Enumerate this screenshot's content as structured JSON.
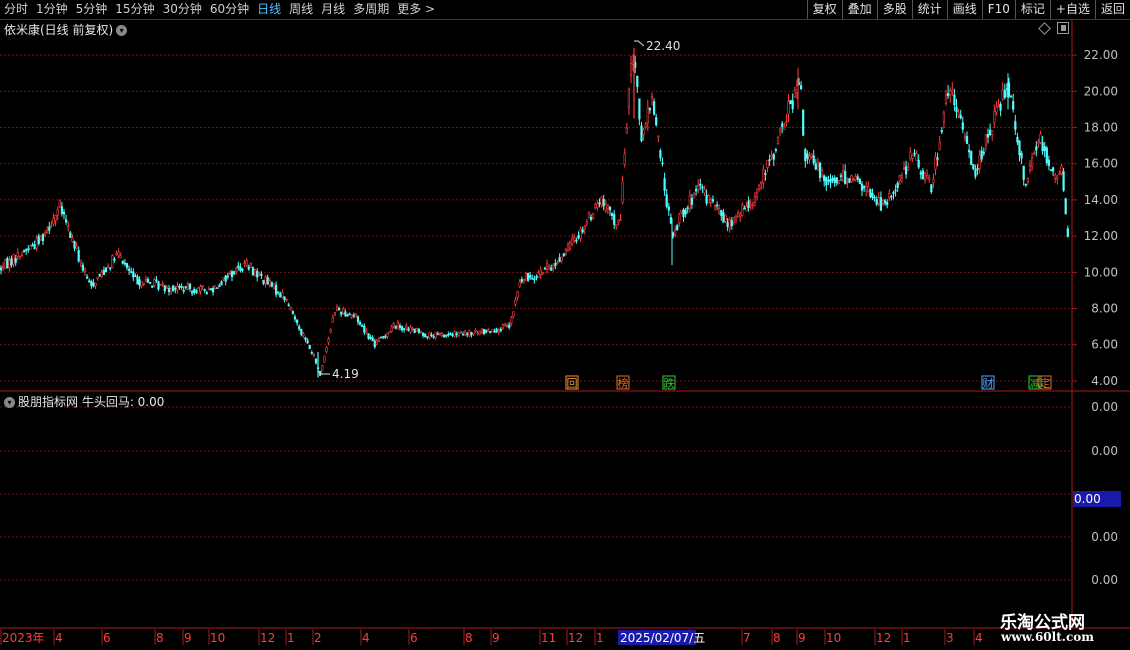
{
  "toolbar": {
    "periods": [
      {
        "label": "分时",
        "active": false
      },
      {
        "label": "1分钟",
        "active": false
      },
      {
        "label": "5分钟",
        "active": false
      },
      {
        "label": "15分钟",
        "active": false
      },
      {
        "label": "30分钟",
        "active": false
      },
      {
        "label": "60分钟",
        "active": false
      },
      {
        "label": "日线",
        "active": true
      },
      {
        "label": "周线",
        "active": false
      },
      {
        "label": "月线",
        "active": false
      },
      {
        "label": "多周期",
        "active": false
      },
      {
        "label": "更多 >",
        "active": false
      }
    ],
    "tools": [
      "复权",
      "叠加",
      "多股",
      "统计",
      "画线",
      "F10",
      "标记",
      "+自选",
      "返回"
    ]
  },
  "stock": {
    "name": "依米康(日线 前复权)",
    "high_label": "22.40",
    "low_label": "4.19"
  },
  "price_axis": {
    "ticks": [
      "22.00",
      "20.00",
      "18.00",
      "16.00",
      "14.00",
      "12.00",
      "10.00",
      "8.00",
      "6.00",
      "4.00"
    ]
  },
  "event_markers": [
    {
      "label": "回",
      "color": "#e89a40"
    },
    {
      "label": "榜",
      "color": "#e07020"
    },
    {
      "label": "跌",
      "color": "#33cc33"
    },
    {
      "label": "财",
      "color": "#4fa8ff"
    },
    {
      "label": "减",
      "color": "#33cc33"
    },
    {
      "label": "定",
      "color": "#e07020"
    }
  ],
  "indicator": {
    "header": "股朋指标网 牛头回马: 0.00",
    "ticks": [
      "0.00",
      "0.00",
      "0.00",
      "0.00",
      "0.00"
    ],
    "current_value": "0.00"
  },
  "date_axis": {
    "labels": [
      "2023年",
      "4",
      "6",
      "8",
      "9",
      "10",
      "12",
      "1",
      "2",
      "4",
      "6",
      "8",
      "9",
      "11",
      "12",
      "1",
      "5",
      "7",
      "8",
      "9",
      "10",
      "12",
      "1",
      "3",
      "4"
    ],
    "cursor_date": "2025/02/07/五"
  },
  "brand": {
    "name": "乐淘公式网",
    "url": "www.60lt.com"
  },
  "colors": {
    "up": "#ff3c3c",
    "down": "#54fcfc",
    "grid": "#7a1010",
    "axis_text": "#c0c0c0"
  },
  "chart_data": {
    "type": "candlestick",
    "title": "依米康(日线 前复权)",
    "ylim": [
      3.5,
      23.0
    ],
    "anchors": [
      [
        0,
        10.2
      ],
      [
        40,
        11.8
      ],
      [
        60,
        13.6
      ],
      [
        90,
        9.2
      ],
      [
        118,
        11.0
      ],
      [
        135,
        9.6
      ],
      [
        165,
        9.2
      ],
      [
        210,
        9.0
      ],
      [
        245,
        10.5
      ],
      [
        285,
        8.6
      ],
      [
        315,
        5.2
      ],
      [
        320,
        4.3
      ],
      [
        335,
        8.0
      ],
      [
        355,
        7.6
      ],
      [
        375,
        6.0
      ],
      [
        395,
        7.1
      ],
      [
        430,
        6.5
      ],
      [
        470,
        6.6
      ],
      [
        510,
        7.0
      ],
      [
        520,
        9.5
      ],
      [
        555,
        10.4
      ],
      [
        580,
        12.2
      ],
      [
        600,
        14.0
      ],
      [
        620,
        12.5
      ],
      [
        628,
        19.5
      ],
      [
        634,
        22.4
      ],
      [
        642,
        17.0
      ],
      [
        652,
        19.8
      ],
      [
        665,
        14.6
      ],
      [
        673,
        11.8
      ],
      [
        680,
        13.2
      ],
      [
        700,
        14.6
      ],
      [
        730,
        12.6
      ],
      [
        755,
        14.2
      ],
      [
        775,
        16.8
      ],
      [
        790,
        19.2
      ],
      [
        800,
        20.5
      ],
      [
        805,
        16.5
      ],
      [
        830,
        15.0
      ],
      [
        850,
        15.4
      ],
      [
        885,
        13.6
      ],
      [
        912,
        16.5
      ],
      [
        932,
        14.8
      ],
      [
        948,
        20.2
      ],
      [
        960,
        18.4
      ],
      [
        975,
        15.6
      ],
      [
        990,
        17.8
      ],
      [
        1008,
        20.6
      ],
      [
        1025,
        15.0
      ],
      [
        1040,
        17.5
      ],
      [
        1055,
        15.2
      ],
      [
        1062,
        15.8
      ],
      [
        1068,
        11.8
      ]
    ]
  }
}
